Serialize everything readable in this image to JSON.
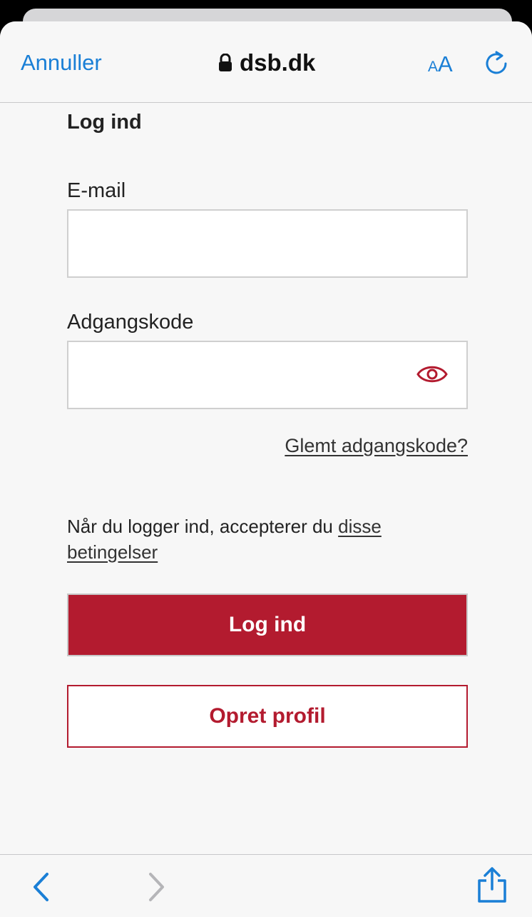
{
  "topbar": {
    "cancel_label": "Annuller",
    "domain": "dsb.dk",
    "text_size_small": "A",
    "text_size_big": "A"
  },
  "form": {
    "title": "Log ind",
    "email_label": "E-mail",
    "email_value": "",
    "password_label": "Adgangskode",
    "password_value": "",
    "forgot_link": "Glemt adgangskode?",
    "terms_text": "Når du logger ind, accepterer du ",
    "terms_link": "disse betingelser",
    "login_button": "Log ind",
    "create_profile_button": "Opret profil"
  },
  "colors": {
    "accent_blue": "#1a7fd6",
    "brand_red": "#b31b2f"
  },
  "icons": [
    "lock-icon",
    "text-size-icon",
    "reload-icon",
    "eye-icon",
    "back-icon",
    "forward-icon",
    "share-icon"
  ]
}
